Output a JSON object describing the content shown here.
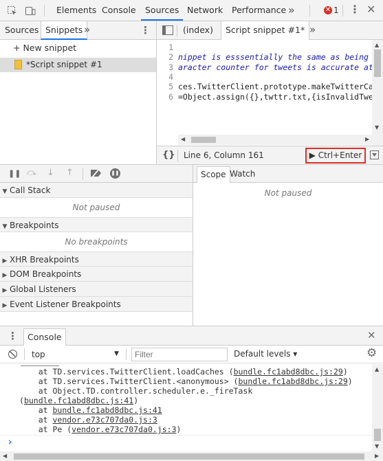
{
  "toolbar": {
    "tabs": [
      "Elements",
      "Console",
      "Sources",
      "Network",
      "Performance"
    ],
    "selected_tab": "Sources",
    "more_label": "»",
    "error_count": "1"
  },
  "navigator": {
    "tabs": [
      "Sources",
      "Snippets"
    ],
    "more_label": "»",
    "new_snippet_label": "+ New snippet",
    "snippet_name": "*Script snippet #1"
  },
  "editor": {
    "tabs": [
      "(index)",
      "Script snippet #1*"
    ],
    "more_label": "»",
    "lines": [
      {
        "n": "1",
        "text": ""
      },
      {
        "n": "2",
        "text": "nippet is esssentially the same as being ir"
      },
      {
        "n": "3",
        "text": "aracter counter for tweets is accurate at t"
      },
      {
        "n": "4",
        "text": ""
      },
      {
        "n": "5",
        "text": "ces.TwitterClient.prototype.makeTwitterCall"
      },
      {
        "n": "6",
        "text": "=Object.assign({},twttr.txt,{isInvalidTweet"
      }
    ],
    "format_label": "{}",
    "cursor_position": "Line 6, Column 161",
    "run_label": "▶ Ctrl+Enter"
  },
  "debugger": {
    "call_stack_label": "Call Stack",
    "not_paused": "Not paused",
    "breakpoints_label": "Breakpoints",
    "no_breakpoints": "No breakpoints",
    "xhr_label": "XHR Breakpoints",
    "dom_label": "DOM Breakpoints",
    "global_label": "Global Listeners",
    "event_label": "Event Listener Breakpoints",
    "scope_tab": "Scope",
    "watch_tab": "Watch",
    "scope_not_paused": "Not paused"
  },
  "console": {
    "tab_label": "Console",
    "context": "top",
    "filter_placeholder": "Filter",
    "levels": "Default levels ▾",
    "lines": [
      {
        "prefix": "    at TD.services.TwitterClient.loadCaches (",
        "link": "bundle.fc1abd8dbc.js:29",
        "suffix": ")"
      },
      {
        "prefix": "    at TD.services.TwitterClient.<anonymous> (",
        "link": "bundle.fc1abd8dbc.js:29",
        "suffix": ")"
      },
      {
        "prefix": "    at Object.TD.controller.scheduler.e._fireTask",
        "link": "",
        "suffix": ""
      },
      {
        "prefix": "(",
        "link": "bundle.fc1abd8dbc.js:41",
        "suffix": ")"
      },
      {
        "prefix": "    at ",
        "link": "bundle.fc1abd8dbc.js:41",
        "suffix": ""
      },
      {
        "prefix": "    at ",
        "link": "vendor.e73c707da0.js:3",
        "suffix": ""
      },
      {
        "prefix": "    at Pe (",
        "link": "vendor.e73c707da0.js:3",
        "suffix": ")"
      }
    ],
    "prompt": "›"
  },
  "colors": {
    "accent": "#1a73e8",
    "error": "#d93025",
    "run_border": "#d93025",
    "snippet_selected_bg": "#dddddd"
  }
}
